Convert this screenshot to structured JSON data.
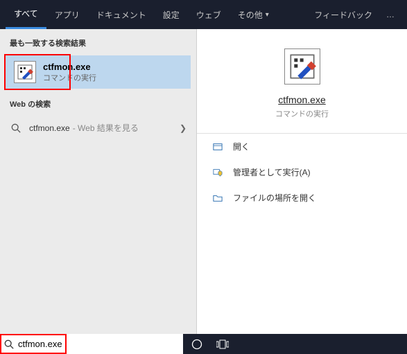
{
  "topbar": {
    "tabs": [
      "すべて",
      "アプリ",
      "ドキュメント",
      "設定",
      "ウェブ",
      "その他"
    ],
    "feedback": "フィードバック"
  },
  "left": {
    "best_header": "最も一致する検索結果",
    "best_match": {
      "title": "ctfmon.exe",
      "sub": "コマンドの実行"
    },
    "web_header": "Web の検索",
    "web_item": {
      "term": "ctfmon.exe",
      "suffix": " - Web 結果を見る"
    }
  },
  "right": {
    "title": "ctfmon.exe",
    "sub": "コマンドの実行",
    "actions": {
      "open": "開く",
      "admin": "管理者として実行(A)",
      "location": "ファイルの場所を開く"
    }
  },
  "search": {
    "value": "ctfmon.exe"
  }
}
